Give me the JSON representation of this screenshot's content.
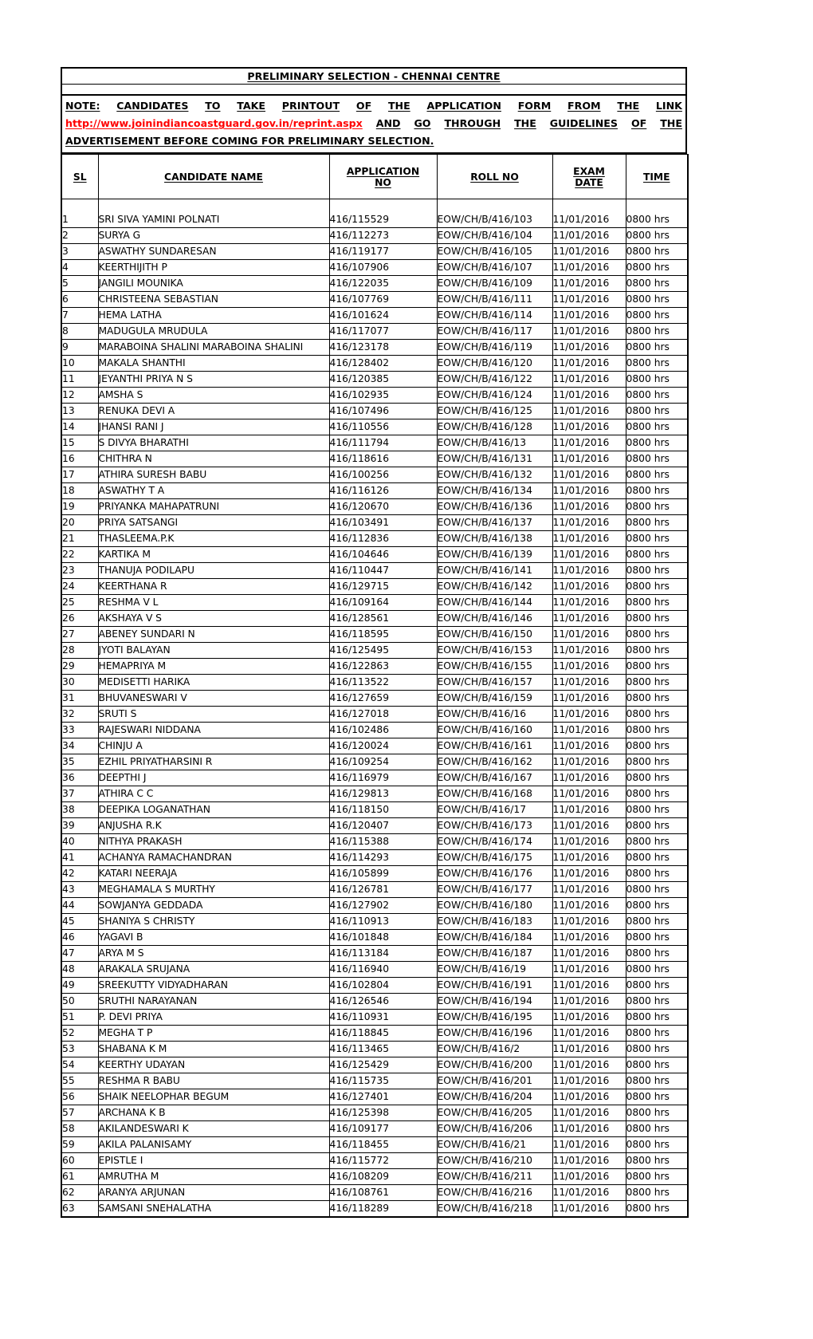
{
  "document": {
    "title": "PRELIMINARY SELECTION - CHENNAI  CENTRE",
    "note": {
      "line1_words": [
        "NOTE:",
        "CANDIDATES",
        "TO",
        "TAKE",
        "PRINTOUT",
        "OF",
        "THE",
        "APPLICATION",
        "FORM",
        "FROM",
        "THE",
        "LINK"
      ],
      "link": "http://www.joinindiancoastguard.gov.in/reprint.aspx",
      "line2_words": [
        "AND",
        "GO",
        "THROUGH",
        "THE",
        "GUIDELINES",
        "OF",
        "THE"
      ],
      "line3": "ADVERTISEMENT BEFORE COMING FOR  PRELIMINARY SELECTION.",
      "link_color": "#ff0000"
    },
    "columns": [
      "SL",
      "CANDIDATE NAME",
      "APPLICATION NO",
      "ROLL NO",
      "EXAM DATE",
      "TIME"
    ],
    "column_header_parts": {
      "sl": "SL",
      "candidate_name": "CANDIDATE NAME",
      "application_no_line1": "APPLICATION ",
      "application_no_line2": "NO",
      "roll_no": "ROLL NO",
      "exam_date_line1": "EXAM ",
      "exam_date_line2": "DATE",
      "time": "TIME"
    },
    "rows": [
      {
        "sl": "1",
        "name": "SRI SIVA YAMINI POLNATI",
        "app_no": "416/115529",
        "roll_no": "EOW/CH/B/416/103",
        "exam_date": "11/01/2016",
        "time": "0800 hrs"
      },
      {
        "sl": "2",
        "name": "SURYA  G",
        "app_no": "416/112273",
        "roll_no": "EOW/CH/B/416/104",
        "exam_date": "11/01/2016",
        "time": "0800 hrs"
      },
      {
        "sl": "3",
        "name": "ASWATHY  SUNDARESAN",
        "app_no": "416/119177",
        "roll_no": "EOW/CH/B/416/105",
        "exam_date": "11/01/2016",
        "time": "0800 hrs"
      },
      {
        "sl": "4",
        "name": "KEERTHIJITH  P",
        "app_no": "416/107906",
        "roll_no": "EOW/CH/B/416/107",
        "exam_date": "11/01/2016",
        "time": "0800 hrs"
      },
      {
        "sl": "5",
        "name": "JANGILI  MOUNIKA",
        "app_no": "416/122035",
        "roll_no": "EOW/CH/B/416/109",
        "exam_date": "11/01/2016",
        "time": "0800 hrs"
      },
      {
        "sl": "6",
        "name": "CHRISTEENA  SEBASTIAN",
        "app_no": "416/107769",
        "roll_no": "EOW/CH/B/416/111",
        "exam_date": "11/01/2016",
        "time": "0800 hrs"
      },
      {
        "sl": "7",
        "name": "HEMA LATHA",
        "app_no": "416/101624",
        "roll_no": "EOW/CH/B/416/114",
        "exam_date": "11/01/2016",
        "time": "0800 hrs"
      },
      {
        "sl": "8",
        "name": "MADUGULA MRUDULA",
        "app_no": "416/117077",
        "roll_no": "EOW/CH/B/416/117",
        "exam_date": "11/01/2016",
        "time": "0800 hrs"
      },
      {
        "sl": "9",
        "name": "MARABOINA SHALINI  MARABOINA SHALINI",
        "app_no": "416/123178",
        "roll_no": "EOW/CH/B/416/119",
        "exam_date": "11/01/2016",
        "time": "0800 hrs"
      },
      {
        "sl": "10",
        "name": "MAKALA  SHANTHI",
        "app_no": "416/128402",
        "roll_no": "EOW/CH/B/416/120",
        "exam_date": "11/01/2016",
        "time": "0800 hrs"
      },
      {
        "sl": "11",
        "name": "JEYANTHI PRIYA N S",
        "app_no": "416/120385",
        "roll_no": "EOW/CH/B/416/122",
        "exam_date": "11/01/2016",
        "time": "0800 hrs"
      },
      {
        "sl": "12",
        "name": "AMSHA  S",
        "app_no": "416/102935",
        "roll_no": "EOW/CH/B/416/124",
        "exam_date": "11/01/2016",
        "time": "0800 hrs"
      },
      {
        "sl": "13",
        "name": "RENUKA DEVI A",
        "app_no": "416/107496",
        "roll_no": "EOW/CH/B/416/125",
        "exam_date": "11/01/2016",
        "time": "0800 hrs"
      },
      {
        "sl": "14",
        "name": "JHANSI RANI J",
        "app_no": "416/110556",
        "roll_no": "EOW/CH/B/416/128",
        "exam_date": "11/01/2016",
        "time": "0800 hrs"
      },
      {
        "sl": "15",
        "name": "S DIVYA BHARATHI",
        "app_no": "416/111794",
        "roll_no": "EOW/CH/B/416/13",
        "exam_date": "11/01/2016",
        "time": "0800 hrs"
      },
      {
        "sl": "16",
        "name": "CHITHRA N",
        "app_no": "416/118616",
        "roll_no": "EOW/CH/B/416/131",
        "exam_date": "11/01/2016",
        "time": "0800 hrs"
      },
      {
        "sl": "17",
        "name": "ATHIRA  SURESH BABU",
        "app_no": "416/100256",
        "roll_no": "EOW/CH/B/416/132",
        "exam_date": "11/01/2016",
        "time": "0800 hrs"
      },
      {
        "sl": "18",
        "name": "ASWATHY T A",
        "app_no": "416/116126",
        "roll_no": "EOW/CH/B/416/134",
        "exam_date": "11/01/2016",
        "time": "0800 hrs"
      },
      {
        "sl": "19",
        "name": "PRIYANKA  MAHAPATRUNI",
        "app_no": "416/120670",
        "roll_no": "EOW/CH/B/416/136",
        "exam_date": "11/01/2016",
        "time": "0800 hrs"
      },
      {
        "sl": "20",
        "name": "PRIYA  SATSANGI",
        "app_no": "416/103491",
        "roll_no": "EOW/CH/B/416/137",
        "exam_date": "11/01/2016",
        "time": "0800 hrs"
      },
      {
        "sl": "21",
        "name": "THASLEEMA.P.K",
        "app_no": "416/112836",
        "roll_no": "EOW/CH/B/416/138",
        "exam_date": "11/01/2016",
        "time": "0800 hrs"
      },
      {
        "sl": "22",
        "name": "KARTIKA  M",
        "app_no": "416/104646",
        "roll_no": "EOW/CH/B/416/139",
        "exam_date": "11/01/2016",
        "time": "0800 hrs"
      },
      {
        "sl": "23",
        "name": "THANUJA  PODILAPU",
        "app_no": "416/110447",
        "roll_no": "EOW/CH/B/416/141",
        "exam_date": "11/01/2016",
        "time": "0800 hrs"
      },
      {
        "sl": "24",
        "name": "KEERTHANA R",
        "app_no": "416/129715",
        "roll_no": "EOW/CH/B/416/142",
        "exam_date": "11/01/2016",
        "time": "0800 hrs"
      },
      {
        "sl": "25",
        "name": "RESHMA  V L",
        "app_no": "416/109164",
        "roll_no": "EOW/CH/B/416/144",
        "exam_date": "11/01/2016",
        "time": "0800 hrs"
      },
      {
        "sl": "26",
        "name": "AKSHAYA V S",
        "app_no": "416/128561",
        "roll_no": "EOW/CH/B/416/146",
        "exam_date": "11/01/2016",
        "time": "0800 hrs"
      },
      {
        "sl": "27",
        "name": "ABENEY SUNDARI N",
        "app_no": "416/118595",
        "roll_no": "EOW/CH/B/416/150",
        "exam_date": "11/01/2016",
        "time": "0800 hrs"
      },
      {
        "sl": "28",
        "name": "JYOTI  BALAYAN",
        "app_no": "416/125495",
        "roll_no": "EOW/CH/B/416/153",
        "exam_date": "11/01/2016",
        "time": "0800 hrs"
      },
      {
        "sl": "29",
        "name": "HEMAPRIYA  M",
        "app_no": "416/122863",
        "roll_no": "EOW/CH/B/416/155",
        "exam_date": "11/01/2016",
        "time": "0800 hrs"
      },
      {
        "sl": "30",
        "name": "MEDISETTI HARIKA",
        "app_no": "416/113522",
        "roll_no": "EOW/CH/B/416/157",
        "exam_date": "11/01/2016",
        "time": "0800 hrs"
      },
      {
        "sl": "31",
        "name": "BHUVANESWARI  V",
        "app_no": "416/127659",
        "roll_no": "EOW/CH/B/416/159",
        "exam_date": "11/01/2016",
        "time": "0800 hrs"
      },
      {
        "sl": "32",
        "name": "SRUTI S",
        "app_no": "416/127018",
        "roll_no": "EOW/CH/B/416/16",
        "exam_date": "11/01/2016",
        "time": "0800 hrs"
      },
      {
        "sl": "33",
        "name": "RAJESWARI  NIDDANA",
        "app_no": "416/102486",
        "roll_no": "EOW/CH/B/416/160",
        "exam_date": "11/01/2016",
        "time": "0800 hrs"
      },
      {
        "sl": "34",
        "name": "CHINJU  A",
        "app_no": "416/120024",
        "roll_no": "EOW/CH/B/416/161",
        "exam_date": "11/01/2016",
        "time": "0800 hrs"
      },
      {
        "sl": "35",
        "name": "EZHIL PRIYATHARSINI R",
        "app_no": "416/109254",
        "roll_no": "EOW/CH/B/416/162",
        "exam_date": "11/01/2016",
        "time": "0800 hrs"
      },
      {
        "sl": "36",
        "name": "DEEPTHI J",
        "app_no": "416/116979",
        "roll_no": "EOW/CH/B/416/167",
        "exam_date": "11/01/2016",
        "time": "0800 hrs"
      },
      {
        "sl": "37",
        "name": "ATHIRA C C",
        "app_no": "416/129813",
        "roll_no": "EOW/CH/B/416/168",
        "exam_date": "11/01/2016",
        "time": "0800 hrs"
      },
      {
        "sl": "38",
        "name": "DEEPIKA  LOGANATHAN",
        "app_no": "416/118150",
        "roll_no": "EOW/CH/B/416/17",
        "exam_date": "11/01/2016",
        "time": "0800 hrs"
      },
      {
        "sl": "39",
        "name": "ANJUSHA  R.K",
        "app_no": "416/120407",
        "roll_no": "EOW/CH/B/416/173",
        "exam_date": "11/01/2016",
        "time": "0800 hrs"
      },
      {
        "sl": "40",
        "name": "NITHYA  PRAKASH",
        "app_no": "416/115388",
        "roll_no": "EOW/CH/B/416/174",
        "exam_date": "11/01/2016",
        "time": "0800 hrs"
      },
      {
        "sl": "41",
        "name": "ACHANYA  RAMACHANDRAN",
        "app_no": "416/114293",
        "roll_no": "EOW/CH/B/416/175",
        "exam_date": "11/01/2016",
        "time": "0800 hrs"
      },
      {
        "sl": "42",
        "name": "KATARI NEERAJA",
        "app_no": "416/105899",
        "roll_no": "EOW/CH/B/416/176",
        "exam_date": "11/01/2016",
        "time": "0800 hrs"
      },
      {
        "sl": "43",
        "name": "MEGHAMALA  S MURTHY",
        "app_no": "416/126781",
        "roll_no": "EOW/CH/B/416/177",
        "exam_date": "11/01/2016",
        "time": "0800 hrs"
      },
      {
        "sl": "44",
        "name": "SOWJANYA  GEDDADA",
        "app_no": "416/127902",
        "roll_no": "EOW/CH/B/416/180",
        "exam_date": "11/01/2016",
        "time": "0800 hrs"
      },
      {
        "sl": "45",
        "name": "SHANIYA S CHRISTY",
        "app_no": "416/110913",
        "roll_no": "EOW/CH/B/416/183",
        "exam_date": "11/01/2016",
        "time": "0800 hrs"
      },
      {
        "sl": "46",
        "name": "YAGAVI  B",
        "app_no": "416/101848",
        "roll_no": "EOW/CH/B/416/184",
        "exam_date": "11/01/2016",
        "time": "0800 hrs"
      },
      {
        "sl": "47",
        "name": "ARYA M S",
        "app_no": "416/113184",
        "roll_no": "EOW/CH/B/416/187",
        "exam_date": "11/01/2016",
        "time": "0800 hrs"
      },
      {
        "sl": "48",
        "name": "ARAKALA  SRUJANA",
        "app_no": "416/116940",
        "roll_no": "EOW/CH/B/416/19",
        "exam_date": "11/01/2016",
        "time": "0800 hrs"
      },
      {
        "sl": "49",
        "name": "SREEKUTTY VIDYADHARAN",
        "app_no": "416/102804",
        "roll_no": "EOW/CH/B/416/191",
        "exam_date": "11/01/2016",
        "time": "0800 hrs"
      },
      {
        "sl": "50",
        "name": "SRUTHI  NARAYANAN",
        "app_no": "416/126546",
        "roll_no": "EOW/CH/B/416/194",
        "exam_date": "11/01/2016",
        "time": "0800 hrs"
      },
      {
        "sl": "51",
        "name": "P. DEVI  PRIYA",
        "app_no": "416/110931",
        "roll_no": "EOW/CH/B/416/195",
        "exam_date": "11/01/2016",
        "time": "0800 hrs"
      },
      {
        "sl": "52",
        "name": "MEGHA  T P",
        "app_no": "416/118845",
        "roll_no": "EOW/CH/B/416/196",
        "exam_date": "11/01/2016",
        "time": "0800 hrs"
      },
      {
        "sl": "53",
        "name": "SHABANA K M",
        "app_no": "416/113465",
        "roll_no": "EOW/CH/B/416/2",
        "exam_date": "11/01/2016",
        "time": "0800 hrs"
      },
      {
        "sl": "54",
        "name": "KEERTHY  UDAYAN",
        "app_no": "416/125429",
        "roll_no": "EOW/CH/B/416/200",
        "exam_date": "11/01/2016",
        "time": "0800 hrs"
      },
      {
        "sl": "55",
        "name": "RESHMA R BABU",
        "app_no": "416/115735",
        "roll_no": "EOW/CH/B/416/201",
        "exam_date": "11/01/2016",
        "time": "0800 hrs"
      },
      {
        "sl": "56",
        "name": "SHAIK NEELOPHAR BEGUM",
        "app_no": "416/127401",
        "roll_no": "EOW/CH/B/416/204",
        "exam_date": "11/01/2016",
        "time": "0800 hrs"
      },
      {
        "sl": "57",
        "name": "ARCHANA K B",
        "app_no": "416/125398",
        "roll_no": "EOW/CH/B/416/205",
        "exam_date": "11/01/2016",
        "time": "0800 hrs"
      },
      {
        "sl": "58",
        "name": "AKILANDESWARI K",
        "app_no": "416/109177",
        "roll_no": "EOW/CH/B/416/206",
        "exam_date": "11/01/2016",
        "time": "0800 hrs"
      },
      {
        "sl": "59",
        "name": "AKILA  PALANISAMY",
        "app_no": "416/118455",
        "roll_no": "EOW/CH/B/416/21",
        "exam_date": "11/01/2016",
        "time": "0800 hrs"
      },
      {
        "sl": "60",
        "name": "EPISTLE I",
        "app_no": "416/115772",
        "roll_no": "EOW/CH/B/416/210",
        "exam_date": "11/01/2016",
        "time": "0800 hrs"
      },
      {
        "sl": "61",
        "name": "AMRUTHA  M",
        "app_no": "416/108209",
        "roll_no": "EOW/CH/B/416/211",
        "exam_date": "11/01/2016",
        "time": "0800 hrs"
      },
      {
        "sl": "62",
        "name": "ARANYA  ARJUNAN",
        "app_no": "416/108761",
        "roll_no": "EOW/CH/B/416/216",
        "exam_date": "11/01/2016",
        "time": "0800 hrs"
      },
      {
        "sl": "63",
        "name": "SAMSANI  SNEHALATHA",
        "app_no": "416/118289",
        "roll_no": "EOW/CH/B/416/218",
        "exam_date": "11/01/2016",
        "time": "0800 hrs"
      }
    ]
  }
}
